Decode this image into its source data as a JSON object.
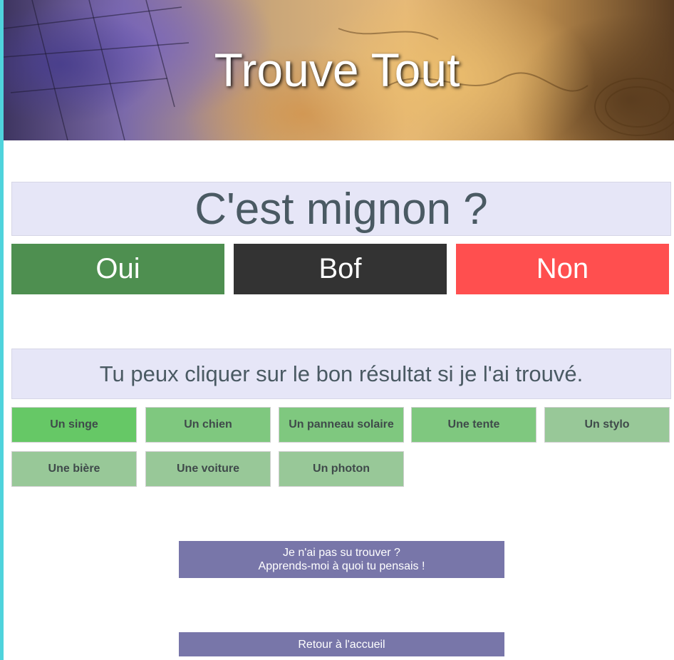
{
  "header": {
    "title": "Trouve Tout"
  },
  "question": {
    "text": "C'est mignon ?"
  },
  "answers": [
    {
      "label": "Oui",
      "color": "#4e8f50"
    },
    {
      "label": "Bof",
      "color": "#333333"
    },
    {
      "label": "Non",
      "color": "#ff4f4f"
    }
  ],
  "hint": {
    "text": "Tu peux cliquer sur le bon résultat si je l'ai trouvé."
  },
  "guesses": [
    {
      "label": "Un singe",
      "color": "#66c866"
    },
    {
      "label": "Un chien",
      "color": "#7fc87f"
    },
    {
      "label": "Un panneau solaire",
      "color": "#7fc87f"
    },
    {
      "label": "Une tente",
      "color": "#7fc87f"
    },
    {
      "label": "Un stylo",
      "color": "#98c898"
    },
    {
      "label": "Une bière",
      "color": "#98c898"
    },
    {
      "label": "Une voiture",
      "color": "#98c898"
    },
    {
      "label": "Un photon",
      "color": "#98c898"
    }
  ],
  "teach_button": {
    "line1": "Je n'ai pas su trouver ?",
    "line2": "Apprends-moi à quoi tu pensais !"
  },
  "home_button": {
    "label": "Retour à l'accueil"
  }
}
